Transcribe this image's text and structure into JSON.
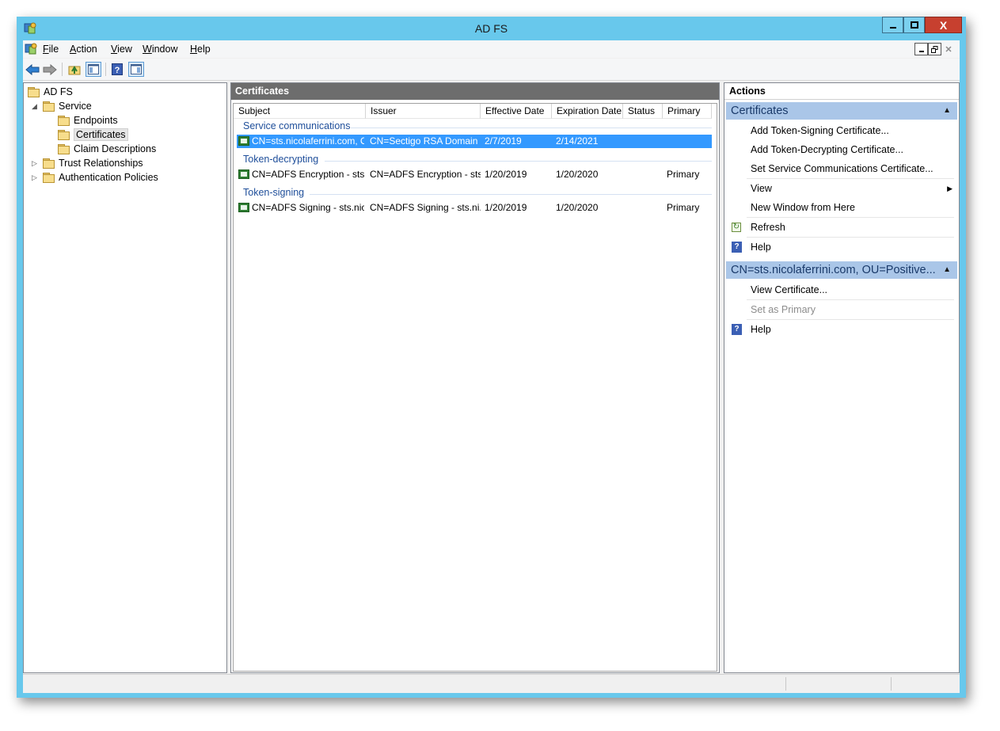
{
  "window": {
    "title": "AD FS",
    "close_label": "X"
  },
  "menu": {
    "items": [
      {
        "label": "File",
        "underline": "F",
        "rest": "ile"
      },
      {
        "label": "Action",
        "underline": "A",
        "rest": "ction"
      },
      {
        "label": "View",
        "underline": "V",
        "rest": "iew"
      },
      {
        "label": "Window",
        "underline": "W",
        "rest": "indow"
      },
      {
        "label": "Help",
        "underline": "H",
        "rest": "elp"
      }
    ]
  },
  "tree": {
    "root": "AD FS",
    "service": "Service",
    "endpoints": "Endpoints",
    "certificates": "Certificates",
    "claim_descriptions": "Claim Descriptions",
    "trust_relationships": "Trust Relationships",
    "authentication_policies": "Authentication Policies"
  },
  "center": {
    "header": "Certificates",
    "columns": [
      "Subject",
      "Issuer",
      "Effective Date",
      "Expiration Date",
      "Status",
      "Primary"
    ],
    "groups": [
      {
        "name": "Service communications",
        "rows": [
          {
            "subject": "CN=sts.nicolaferrini.com, O...",
            "issuer": "CN=Sectigo RSA Domain ...",
            "effective": "2/7/2019",
            "expiration": "2/14/2021",
            "status": "",
            "primary": "",
            "selected": true
          }
        ]
      },
      {
        "name": "Token-decrypting",
        "rows": [
          {
            "subject": "CN=ADFS Encryption - sts....",
            "issuer": "CN=ADFS Encryption - sts...",
            "effective": "1/20/2019",
            "expiration": "1/20/2020",
            "status": "",
            "primary": "Primary",
            "selected": false
          }
        ]
      },
      {
        "name": "Token-signing",
        "rows": [
          {
            "subject": "CN=ADFS Signing - sts.nic...",
            "issuer": "CN=ADFS Signing - sts.ni...",
            "effective": "1/20/2019",
            "expiration": "1/20/2020",
            "status": "",
            "primary": "Primary",
            "selected": false
          }
        ]
      }
    ]
  },
  "actions": {
    "header": "Actions",
    "section1": {
      "title": "Certificates",
      "items": {
        "add_signing": "Add Token-Signing Certificate...",
        "add_decrypting": "Add Token-Decrypting Certificate...",
        "set_service": "Set Service Communications Certificate...",
        "view": "View",
        "new_window": "New Window from Here",
        "refresh": "Refresh",
        "help": "Help"
      }
    },
    "section2": {
      "title": "CN=sts.nicolaferrini.com, OU=Positive...",
      "items": {
        "view_certificate": "View Certificate...",
        "set_primary": "Set as Primary",
        "help": "Help"
      }
    }
  },
  "colors": {
    "titlebar": "#68c8ec",
    "selection": "#3399ff",
    "section_header": "#aac6e8",
    "center_header": "#6d6d6d",
    "group_text": "#1e4e9a"
  }
}
